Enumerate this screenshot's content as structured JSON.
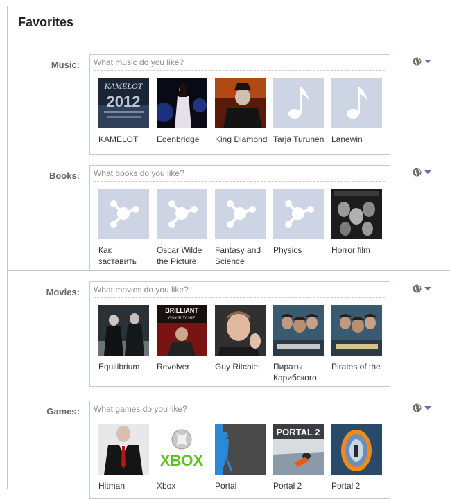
{
  "page": {
    "title": "Favorites"
  },
  "sections": [
    {
      "label": "Music:",
      "placeholder": "What music do you like?",
      "items": [
        {
          "label": "KAMELOT",
          "image": "kamelot-album-cover"
        },
        {
          "label": "Edenbridge",
          "image": "singer-on-stage-photo"
        },
        {
          "label": "King Diamond",
          "image": "performer-stage-photo"
        },
        {
          "label": "Tarja Turunen",
          "image": "music-note-icon"
        },
        {
          "label": "Lanewin",
          "image": "music-note-icon"
        }
      ]
    },
    {
      "label": "Books:",
      "placeholder": "What books do you like?",
      "items": [
        {
          "label": "Как заставить",
          "image": "share-graph-icon"
        },
        {
          "label": "Oscar Wilde the Picture",
          "image": "share-graph-icon"
        },
        {
          "label": "Fantasy and Science",
          "image": "share-graph-icon"
        },
        {
          "label": "Physics",
          "image": "share-graph-icon"
        },
        {
          "label": "Horror film",
          "image": "classic-monsters-poster"
        }
      ]
    },
    {
      "label": "Movies:",
      "placeholder": "What movies do you like?",
      "items": [
        {
          "label": "Equilibrium",
          "image": "equilibrium-poster"
        },
        {
          "label": "Revolver",
          "image": "revolver-poster"
        },
        {
          "label": "Guy Ritchie",
          "image": "guy-ritchie-photo"
        },
        {
          "label": "Пираты Карибского",
          "image": "pirates-poster"
        },
        {
          "label": "Pirates of the",
          "image": "pirates-poster"
        }
      ]
    },
    {
      "label": "Games:",
      "placeholder": "What games do you like?",
      "items": [
        {
          "label": "Hitman",
          "image": "hitman-art"
        },
        {
          "label": "Xbox",
          "image": "xbox-logo"
        },
        {
          "label": "Portal",
          "image": "portal-art"
        },
        {
          "label": "Portal 2",
          "image": "portal-2-cover"
        },
        {
          "label": "Portal 2",
          "image": "portal-2-art"
        }
      ]
    }
  ],
  "logos": {
    "xbox_text": "XBOX",
    "portal2_text": "PORTAL 2",
    "kamelot_text": "KAMELOT",
    "revolver_text": "BRILLIANT"
  },
  "colors": {
    "placeholder_tile": "#cdd4e4",
    "accent": "#5b74a8",
    "xbox_green": "#5dc21e"
  },
  "privacy": {
    "icon": "globe-icon",
    "menu_icon": "caret-down-icon"
  }
}
